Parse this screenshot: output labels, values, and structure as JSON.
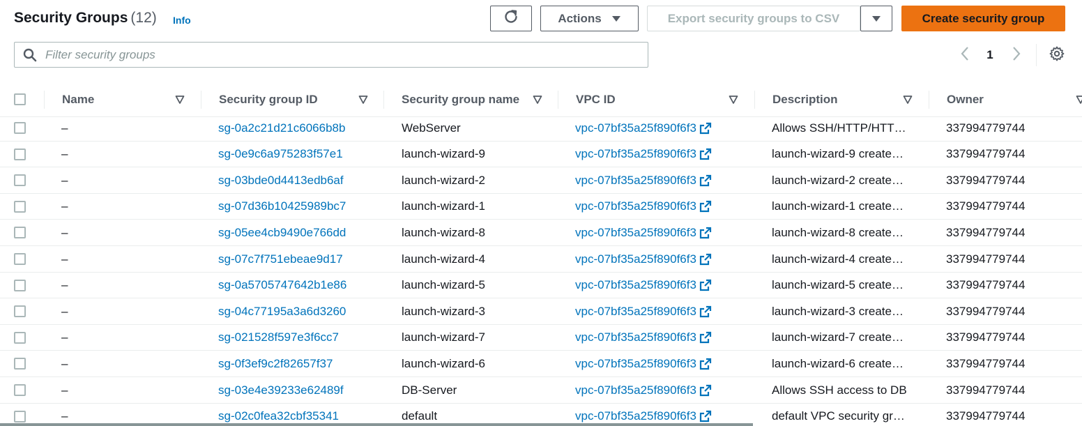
{
  "header": {
    "title": "Security Groups",
    "count": "(12)",
    "info": "Info"
  },
  "toolbar": {
    "actions_label": "Actions",
    "export_label": "Export security groups to CSV",
    "create_label": "Create security group"
  },
  "filter": {
    "placeholder": "Filter security groups",
    "value": ""
  },
  "pagination": {
    "current_page": "1"
  },
  "columns": [
    "Name",
    "Security group ID",
    "Security group name",
    "VPC ID",
    "Description",
    "Owner"
  ],
  "rows": [
    {
      "name": "–",
      "id": "sg-0a2c21d21c6066b8b",
      "group_name": "WebServer",
      "vpc": "vpc-07bf35a25f890f6f3",
      "description": "Allows SSH/HTTP/HTT…",
      "owner": "337994779744"
    },
    {
      "name": "–",
      "id": "sg-0e9c6a975283f57e1",
      "group_name": "launch-wizard-9",
      "vpc": "vpc-07bf35a25f890f6f3",
      "description": "launch-wizard-9 create…",
      "owner": "337994779744"
    },
    {
      "name": "–",
      "id": "sg-03bde0d4413edb6af",
      "group_name": "launch-wizard-2",
      "vpc": "vpc-07bf35a25f890f6f3",
      "description": "launch-wizard-2 create…",
      "owner": "337994779744"
    },
    {
      "name": "–",
      "id": "sg-07d36b10425989bc7",
      "group_name": "launch-wizard-1",
      "vpc": "vpc-07bf35a25f890f6f3",
      "description": "launch-wizard-1 create…",
      "owner": "337994779744"
    },
    {
      "name": "–",
      "id": "sg-05ee4cb9490e766dd",
      "group_name": "launch-wizard-8",
      "vpc": "vpc-07bf35a25f890f6f3",
      "description": "launch-wizard-8 create…",
      "owner": "337994779744"
    },
    {
      "name": "–",
      "id": "sg-07c7f751ebeae9d17",
      "group_name": "launch-wizard-4",
      "vpc": "vpc-07bf35a25f890f6f3",
      "description": "launch-wizard-4 create…",
      "owner": "337994779744"
    },
    {
      "name": "–",
      "id": "sg-0a5705747642b1e86",
      "group_name": "launch-wizard-5",
      "vpc": "vpc-07bf35a25f890f6f3",
      "description": "launch-wizard-5 create…",
      "owner": "337994779744"
    },
    {
      "name": "–",
      "id": "sg-04c77195a3a6d3260",
      "group_name": "launch-wizard-3",
      "vpc": "vpc-07bf35a25f890f6f3",
      "description": "launch-wizard-3 create…",
      "owner": "337994779744"
    },
    {
      "name": "–",
      "id": "sg-021528f597e3f6cc7",
      "group_name": "launch-wizard-7",
      "vpc": "vpc-07bf35a25f890f6f3",
      "description": "launch-wizard-7 create…",
      "owner": "337994779744"
    },
    {
      "name": "–",
      "id": "sg-0f3ef9c2f82657f37",
      "group_name": "launch-wizard-6",
      "vpc": "vpc-07bf35a25f890f6f3",
      "description": "launch-wizard-6 create…",
      "owner": "337994779744"
    },
    {
      "name": "–",
      "id": "sg-03e4e39233e62489f",
      "group_name": "DB-Server",
      "vpc": "vpc-07bf35a25f890f6f3",
      "description": "Allows SSH access to DB",
      "owner": "337994779744"
    },
    {
      "name": "–",
      "id": "sg-02c0fea32cbf35341",
      "group_name": "default",
      "vpc": "vpc-07bf35a25f890f6f3",
      "description": "default VPC security gr…",
      "owner": "337994779744"
    }
  ],
  "colors": {
    "link": "#0073bb",
    "primary_button": "#ec7211",
    "border": "#aab7b8",
    "header_text": "#545b64"
  },
  "icons": [
    "refresh-icon",
    "caret-down-icon",
    "search-icon",
    "chevron-left-icon",
    "chevron-right-icon",
    "gear-icon",
    "sort-icon",
    "external-link-icon"
  ]
}
